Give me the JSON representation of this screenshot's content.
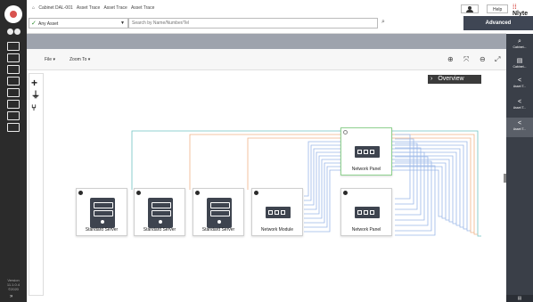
{
  "breadcrumbs": [
    "Cabinet DAL-001",
    "Asset Trace",
    "Asset Trace",
    "Asset Trace"
  ],
  "header": {
    "help_label": "Help",
    "brand": "Nlyte",
    "asset_select": "Any Asset",
    "search_placeholder": "Search by Name/Number/Tel",
    "advanced_label": "Advanced"
  },
  "toolbar": {
    "file_label": "File",
    "zoom_label": "Zoom To"
  },
  "overview_label": "Overview",
  "nodes": [
    {
      "label": "Standard Server"
    },
    {
      "label": "Standard Server"
    },
    {
      "label": "Standard Server"
    },
    {
      "label": "Network Module"
    },
    {
      "label": "Network Panel"
    },
    {
      "label": "Network Panel"
    }
  ],
  "right_panel": [
    {
      "icon": "search-icon",
      "label": "Cabinet..."
    },
    {
      "icon": "cabinet-icon",
      "label": "Cabinet..."
    },
    {
      "icon": "share-icon",
      "label": "Asset T..."
    },
    {
      "icon": "share-icon",
      "label": "Asset T..."
    },
    {
      "icon": "share-icon",
      "label": "Asset T..."
    }
  ],
  "version_text": "Version 11.1.0.4 ©2020",
  "colors": {
    "left_bar": "#2b2b2b",
    "advanced_button": "#3f4654",
    "accent_red": "#d9534f",
    "trace_blue": "#9bb8e8",
    "trace_teal": "#6fc3c3",
    "trace_orange": "#f0b488",
    "selected_border": "#8fd18f"
  }
}
